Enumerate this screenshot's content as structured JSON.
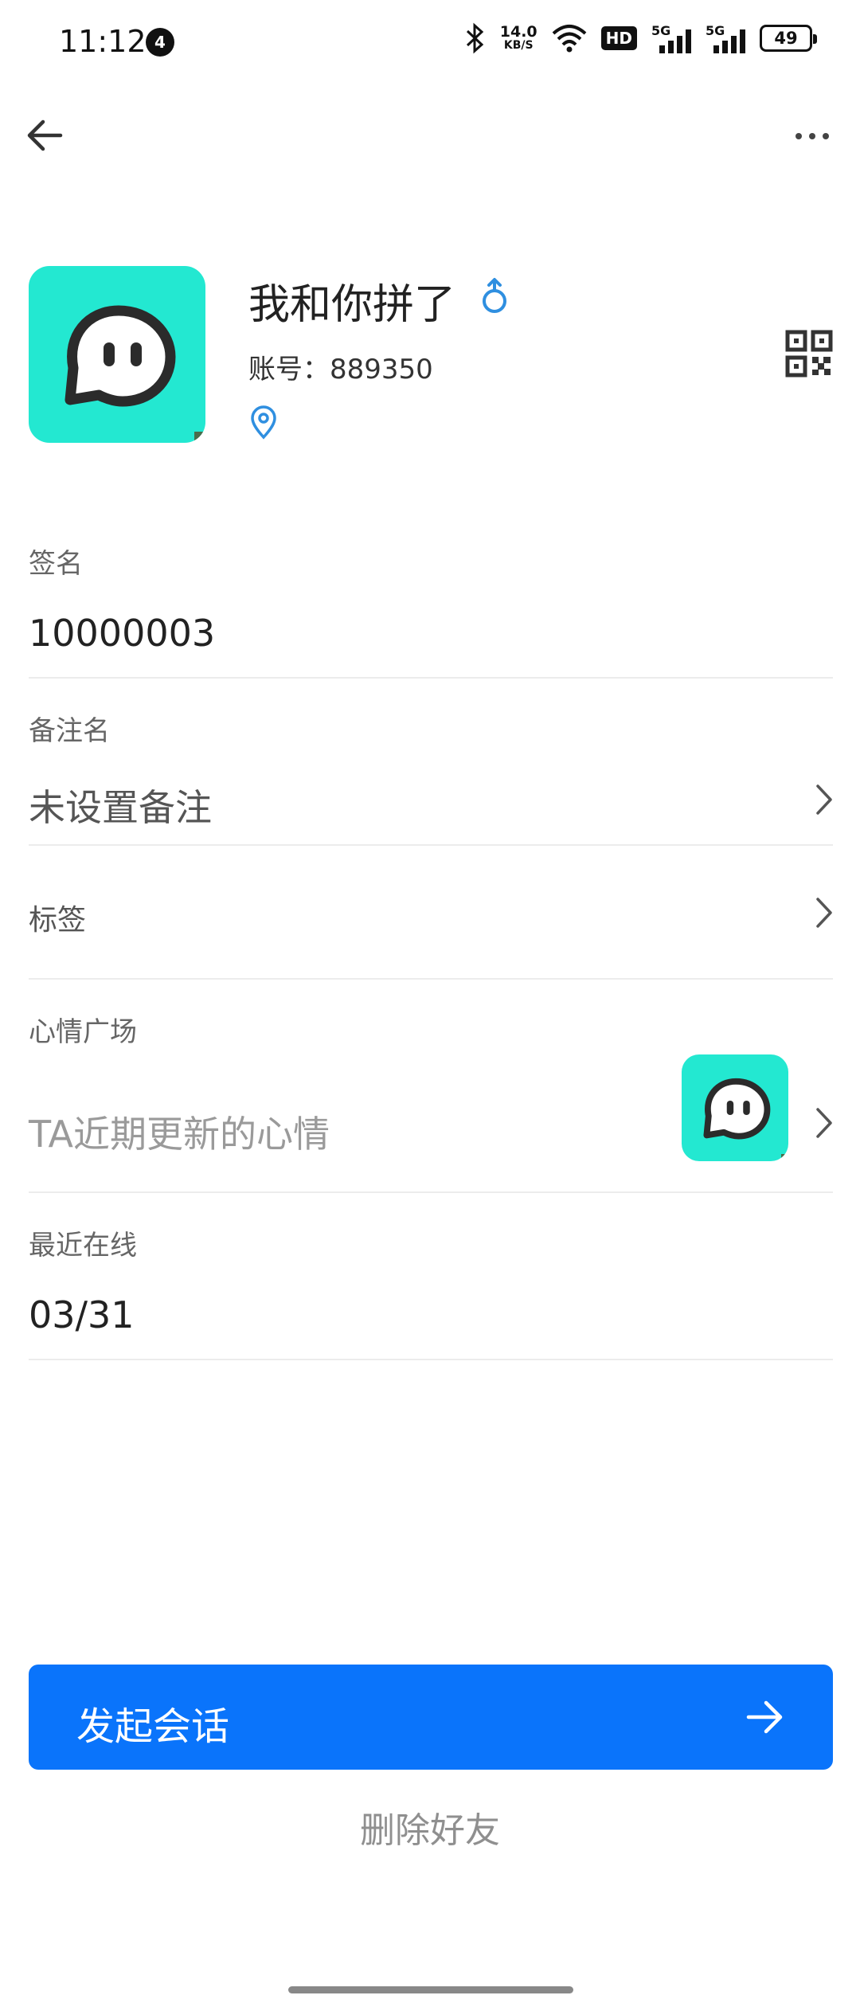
{
  "status_bar": {
    "time": "11:12",
    "notification_count": "4",
    "speed_value": "14.0",
    "speed_unit": "KB/S",
    "hd_label": "HD",
    "net1": "5G",
    "net2": "5G",
    "battery": "49"
  },
  "profile": {
    "name": "我和你拼了",
    "account": "账号：889350",
    "gender_icon": "male-icon",
    "accent_color": "#2f8fe0",
    "avatar_color": "#23e8d1"
  },
  "signature": {
    "label": "签名",
    "value": "10000003"
  },
  "remark": {
    "label": "备注名",
    "value": "未设置备注"
  },
  "tags": {
    "label": "标签"
  },
  "mood": {
    "label": "心情广场",
    "placeholder": "TA近期更新的心情"
  },
  "last_online": {
    "label": "最近在线",
    "value": "03/31"
  },
  "actions": {
    "start_chat": "发起会话",
    "delete_friend": "删除好友",
    "primary_color": "#0a74fb"
  }
}
